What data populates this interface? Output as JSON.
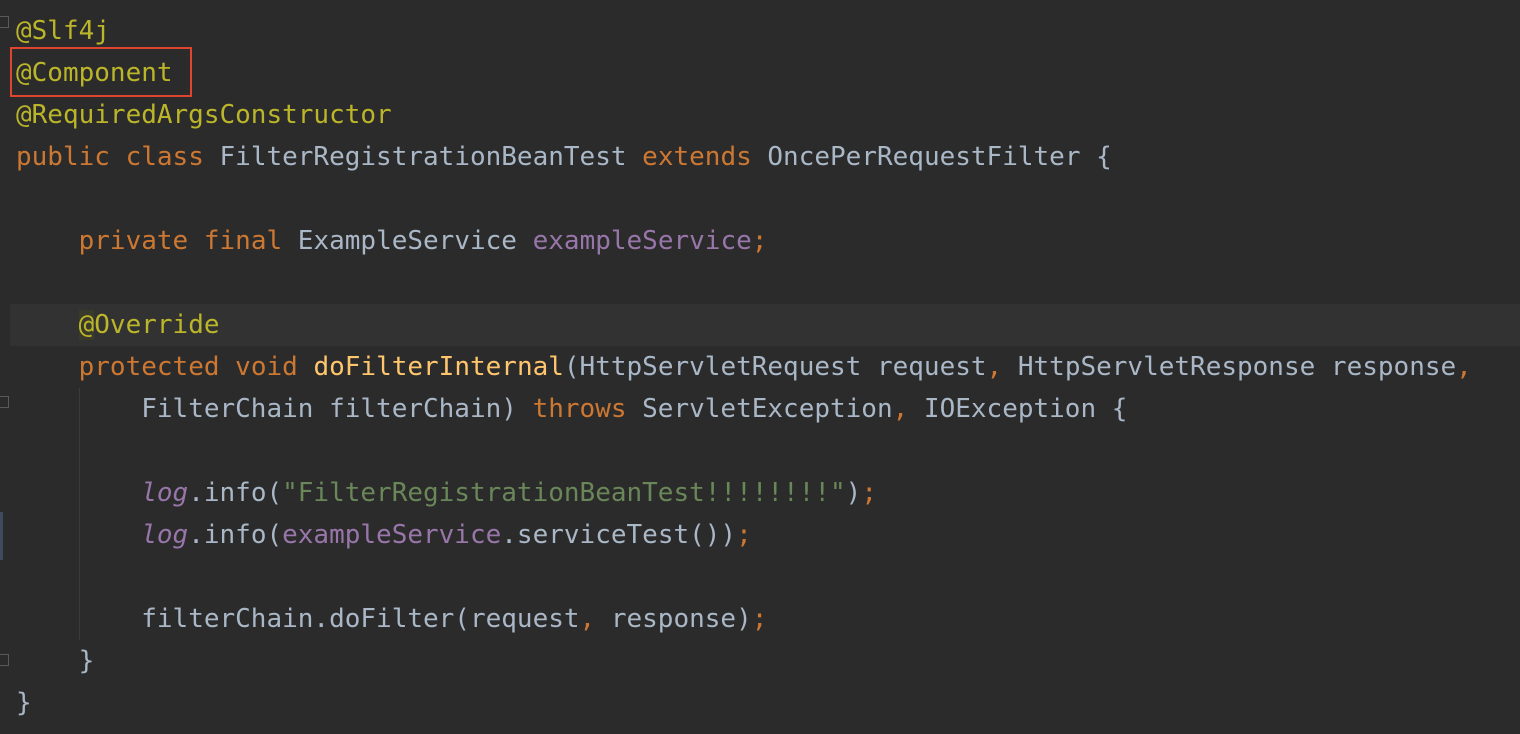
{
  "code": {
    "line1": {
      "annotation": "@Slf4j"
    },
    "line2": {
      "annotation": "@Component"
    },
    "line3": {
      "annotation": "@RequiredArgsConstructor"
    },
    "line4": {
      "kw_public": "public",
      "kw_class": "class",
      "class_name": "FilterRegistrationBeanTest",
      "kw_extends": "extends",
      "super_class": "OncePerRequestFilter",
      "brace": "{"
    },
    "line6": {
      "kw_private": "private",
      "kw_final": "final",
      "type": "ExampleService",
      "field": "exampleService",
      "semicolon": ";"
    },
    "line8": {
      "at": "@",
      "annotation": "Override"
    },
    "line9": {
      "kw_protected": "protected",
      "kw_void": "void",
      "method": "doFilterInternal",
      "params": "(HttpServletRequest request",
      "comma1": ",",
      "params2": " HttpServletResponse response",
      "comma2": ","
    },
    "line10": {
      "params": "FilterChain filterChain)",
      "kw_throws": "throws",
      "exc1": "ServletException",
      "comma": ",",
      "exc2": "IOException {"
    },
    "line12": {
      "log": "log",
      "call": ".info(",
      "string": "\"FilterRegistrationBeanTest!!!!!!!!\"",
      "close": ")",
      "semicolon": ";"
    },
    "line13": {
      "log": "log",
      "call": ".info(",
      "field": "exampleService",
      "rest": ".serviceTest())",
      "semicolon": ";"
    },
    "line15": {
      "call": "filterChain.doFilter(request",
      "comma": ",",
      "rest": " response)",
      "semicolon": ";"
    },
    "line16": {
      "brace": "}"
    },
    "line17": {
      "brace": "}"
    }
  },
  "colors": {
    "background": "#2b2b2b",
    "annotation": "#bbb529",
    "keyword": "#cc7832",
    "plain": "#a9b7c6",
    "field": "#9876aa",
    "method": "#ffc66d",
    "string": "#6a8759",
    "highlight_box": "#e0452f"
  }
}
